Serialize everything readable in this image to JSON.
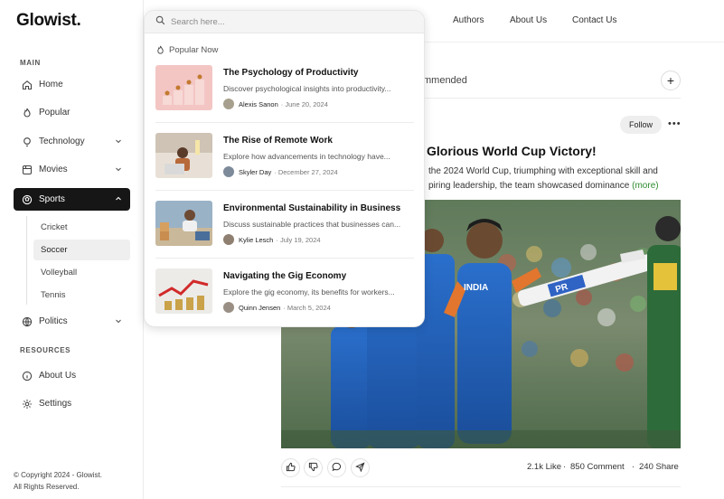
{
  "app": {
    "logo": "Glowist."
  },
  "sidebar": {
    "main_label": "MAIN",
    "resources_label": "RESOURCES",
    "items": [
      {
        "label": "Home",
        "icon": "home-icon"
      },
      {
        "label": "Popular",
        "icon": "flame-icon"
      },
      {
        "label": "Technology",
        "icon": "bulb-icon"
      },
      {
        "label": "Movies",
        "icon": "film-icon"
      },
      {
        "label": "Sports",
        "icon": "ball-icon"
      },
      {
        "label": "Politics",
        "icon": "globe-icon"
      }
    ],
    "sports_sub": [
      "Cricket",
      "Soccer",
      "Volleyball",
      "Tennis"
    ],
    "resources": [
      {
        "label": "About Us",
        "icon": "info-icon"
      },
      {
        "label": "Settings",
        "icon": "gear-icon"
      }
    ],
    "copyright_line1": "© Copyright 2024 - Glowist.",
    "copyright_line2": "All Rights Reserved."
  },
  "topnav": {
    "authors": "Authors",
    "about": "About Us",
    "contact": "Contact Us"
  },
  "search": {
    "placeholder": "Search here...",
    "popular_label": "Popular Now",
    "articles": [
      {
        "title": "The Psychology of Productivity",
        "desc": "Discover psychological insights into productivity...",
        "author": "Alexis Sanon",
        "date": "· June 20, 2024"
      },
      {
        "title": "The Rise of Remote Work",
        "desc": "Explore how advancements in technology have...",
        "author": "Skyler Day",
        "date": "· December 27, 2024"
      },
      {
        "title": "Environmental Sustainability in Business",
        "desc": "Discuss sustainable practices that businesses can...",
        "author": "Kylie Lesch",
        "date": "· July 19, 2024"
      },
      {
        "title": "Navigating the Gig Economy",
        "desc": "Explore the gig economy, its benefits for workers...",
        "author": "Quinn Jensen",
        "date": "· March 5, 2024"
      }
    ]
  },
  "feed": {
    "recommended_partial": "mmended",
    "follow": "Follow",
    "post_title": "Glorious World Cup Victory!",
    "post_line1": "the 2024 World Cup, triumphing with exceptional skill and",
    "post_line2": "piring leadership, the team showcased dominance",
    "more": "(more)",
    "likes": "2.1k Like",
    "comments": "850 Comment",
    "shares": "240 Share",
    "jersey_text": "INDIA",
    "bat_text": "PR"
  },
  "colors": {
    "active_bg": "#161616",
    "more_link": "#2e8b2e",
    "jersey": "#1f5fb8"
  }
}
